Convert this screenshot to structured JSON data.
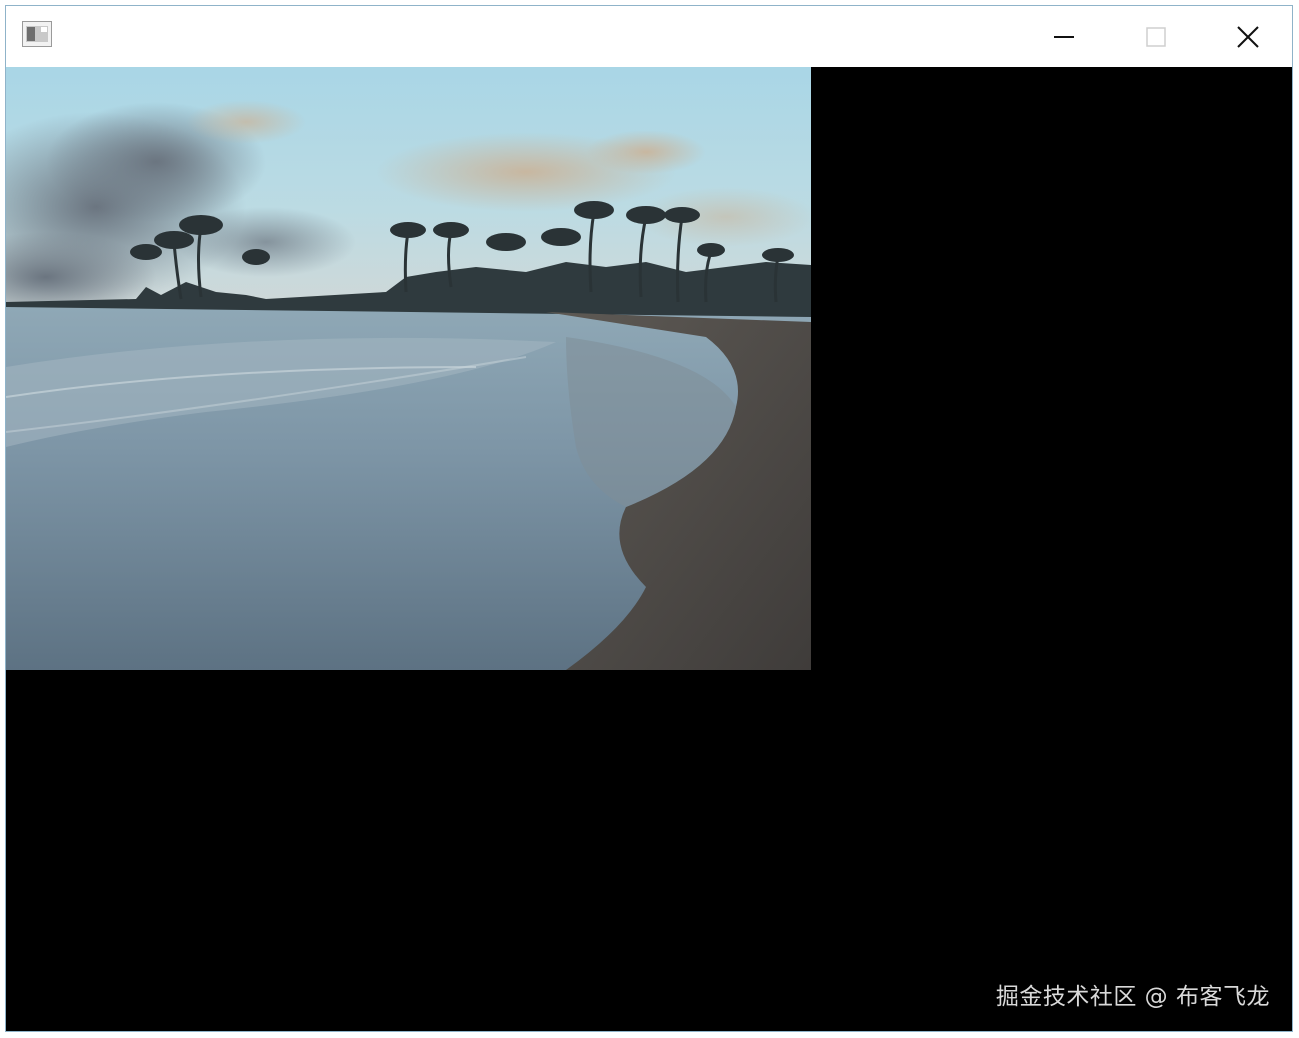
{
  "window": {
    "controls": {
      "minimize_icon": "minimize-icon",
      "maximize_icon": "maximize-icon",
      "close_icon": "close-icon"
    }
  },
  "photo": {
    "subject": "beach-at-dusk-with-palm-trees"
  },
  "watermark": {
    "text": "掘金技术社区 @ 布客飞龙"
  },
  "colors": {
    "background": "#000000",
    "titlebar": "#ffffff",
    "window_border": "#8fb3c9"
  }
}
